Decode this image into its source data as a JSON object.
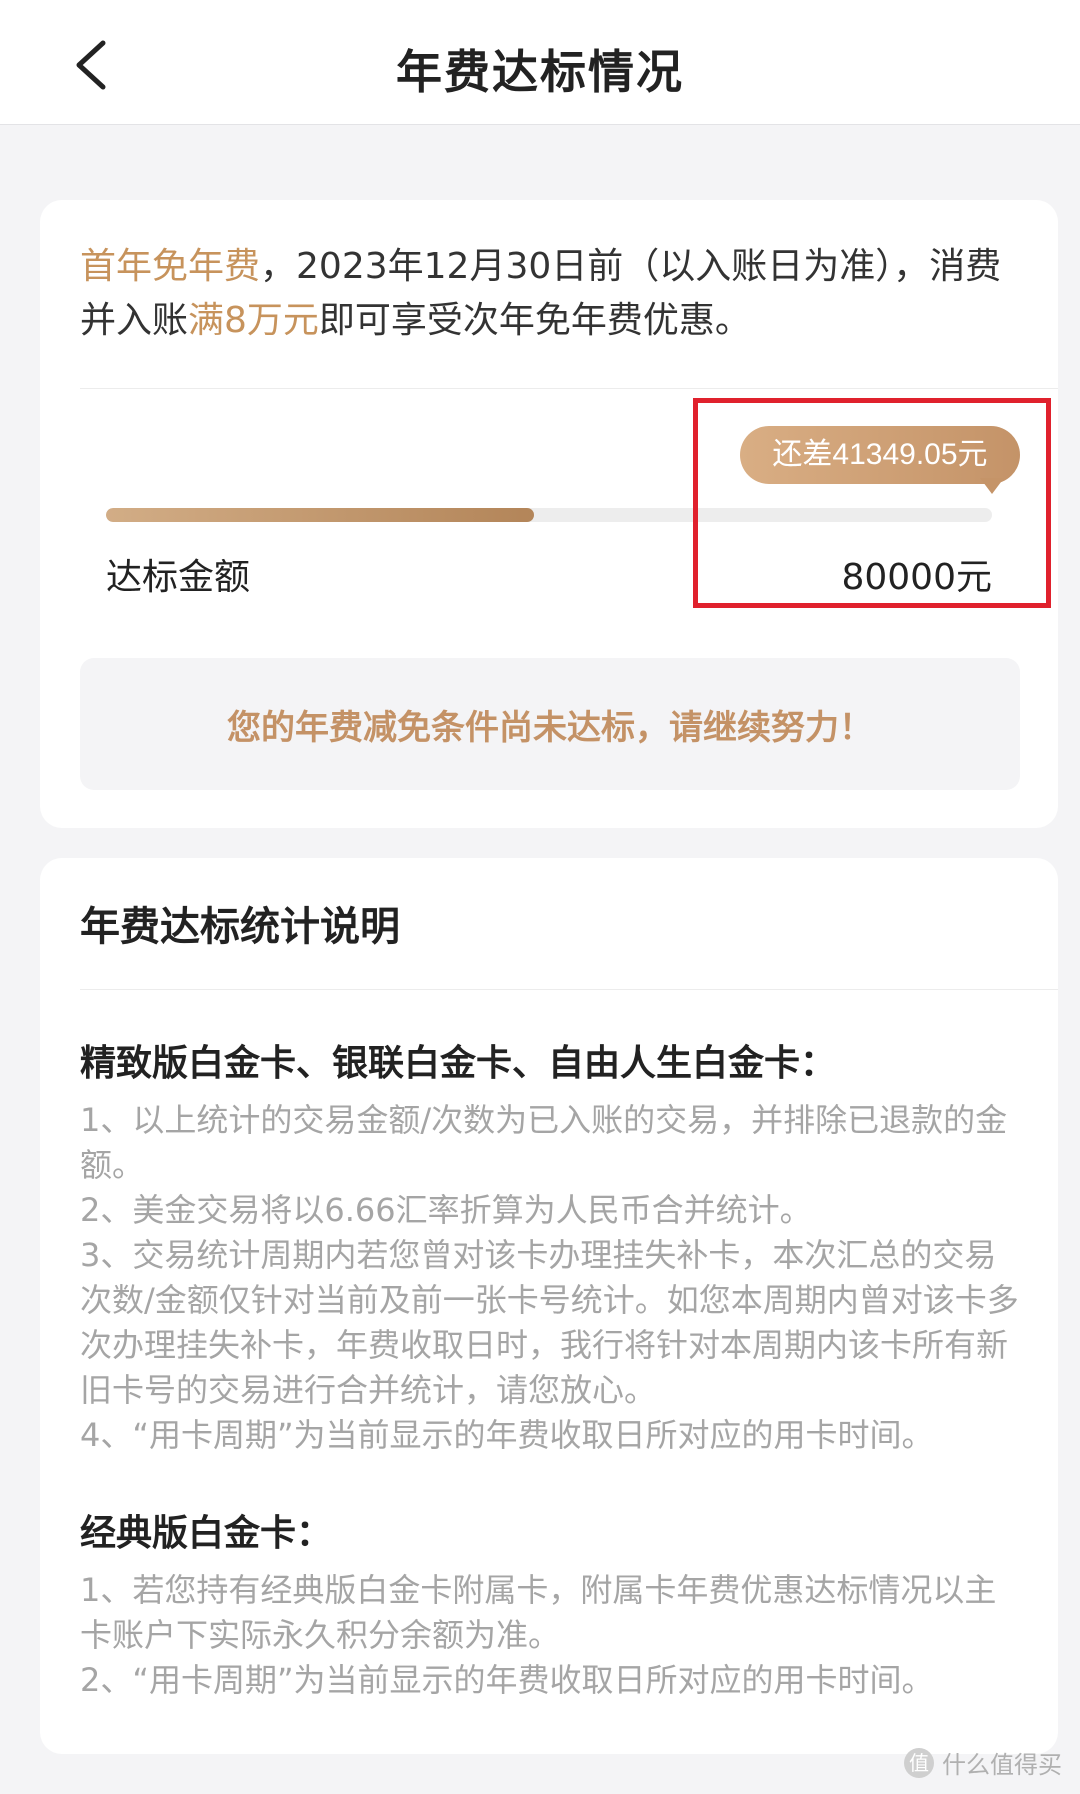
{
  "header": {
    "title": "年费达标情况"
  },
  "summary": {
    "intro_part1": "首年免年费",
    "intro_part2": "，2023年12月30日前（以入账日为准），消费并入账",
    "intro_part3": "满8万元",
    "intro_part4": "即可享受次年免年费优惠。",
    "remaining_badge": "还差41349.05元",
    "progress_fraction": 0.4831,
    "target_label": "达标金额",
    "target_value": "80000元",
    "notice": "您的年费减免条件尚未达标，请继续努力！"
  },
  "details": {
    "title": "年费达标统计说明",
    "section1_title": "精致版白金卡、银联白金卡、自由人生白金卡：",
    "section1_items": [
      "1、以上统计的交易金额/次数为已入账的交易，并排除已退款的金额。",
      "2、美金交易将以6.66汇率折算为人民币合并统计。",
      "3、交易统计周期内若您曾对该卡办理挂失补卡，本次汇总的交易次数/金额仅针对当前及前一张卡号统计。如您本周期内曾对该卡多次办理挂失补卡，年费收取日时，我行将针对本周期内该卡所有新旧卡号的交易进行合并统计，请您放心。",
      "4、“用卡周期”为当前显示的年费收取日所对应的用卡时间。"
    ],
    "section2_title": "经典版白金卡：",
    "section2_items": [
      "1、若您持有经典版白金卡附属卡，附属卡年费优惠达标情况以主卡账户下实际永久积分余额为准。",
      "2、“用卡周期”为当前显示的年费收取日所对应的用卡时间。"
    ]
  },
  "watermark": {
    "icon_text": "值",
    "text": "什么值得买"
  },
  "colors": {
    "accent_gold": "#c7935c",
    "highlight_red": "#e0212d"
  },
  "icons": {
    "back": "chevron-left-icon"
  }
}
